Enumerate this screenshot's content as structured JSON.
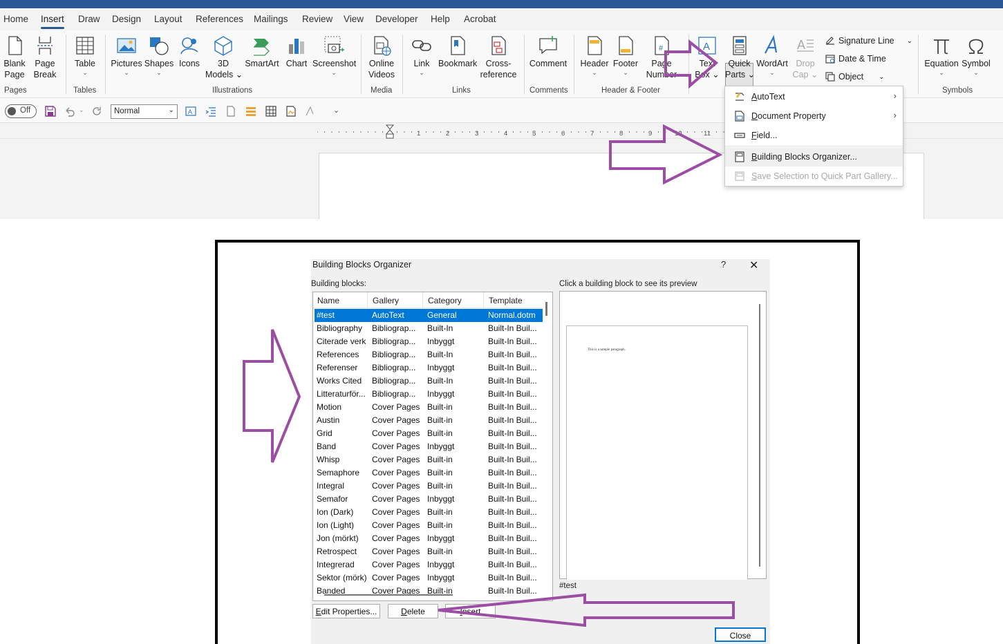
{
  "tabs": [
    "Home",
    "Insert",
    "Draw",
    "Design",
    "Layout",
    "References",
    "Mailings",
    "Review",
    "View",
    "Developer",
    "Help",
    "Acrobat"
  ],
  "active_tab": "Insert",
  "ribbon": {
    "blank_page": [
      "Blank",
      "Page"
    ],
    "page_break": [
      "Page",
      "Break"
    ],
    "table": "Table",
    "pictures": "Pictures",
    "shapes": "Shapes",
    "icons": "Icons",
    "models3d": [
      "3D",
      "Models"
    ],
    "smartart": "SmartArt",
    "chart": "Chart",
    "screenshot": "Screenshot",
    "online_videos": [
      "Online",
      "Videos"
    ],
    "link": "Link",
    "bookmark": "Bookmark",
    "cross_ref": [
      "Cross-",
      "reference"
    ],
    "comment": "Comment",
    "header": "Header",
    "footer": "Footer",
    "page_number": [
      "Page",
      "Number"
    ],
    "text_box": [
      "Text",
      "Box"
    ],
    "quick_parts": [
      "Quick",
      "Parts"
    ],
    "wordart": "WordArt",
    "drop_cap": [
      "Drop",
      "Cap"
    ],
    "signature_line": "Signature Line",
    "date_time": "Date & Time",
    "object": "Object",
    "equation": "Equation",
    "symbol": "Symbol",
    "groups": {
      "pages": "Pages",
      "tables": "Tables",
      "illustrations": "Illustrations",
      "media": "Media",
      "links": "Links",
      "comments": "Comments",
      "header_footer": "Header & Footer",
      "symbols": "Symbols"
    }
  },
  "quick_access": {
    "toggle": "Off",
    "style": "Normal"
  },
  "ruler_ticks": [
    "1",
    "2",
    "3",
    "4",
    "5",
    "6",
    "7",
    "8",
    "9",
    "10",
    "11"
  ],
  "quick_parts_menu": [
    {
      "label": "AutoText",
      "u": "A",
      "rest": "utoText",
      "submenu": true,
      "disabled": false
    },
    {
      "label": "Document Property",
      "u": "D",
      "rest": "ocument Property",
      "submenu": true,
      "disabled": false
    },
    {
      "label": "Field...",
      "u": "F",
      "rest": "ield...",
      "submenu": false,
      "disabled": false
    },
    {
      "label": "Building Blocks Organizer...",
      "u": "B",
      "rest": "uilding Blocks Organizer...",
      "submenu": false,
      "disabled": false
    },
    {
      "label": "Save Selection to Quick Part Gallery...",
      "u": "S",
      "rest": "ave Selection to Quick Part Gallery...",
      "submenu": false,
      "disabled": true
    }
  ],
  "dialog": {
    "title": "Building Blocks Organizer",
    "help": "?",
    "building_blocks_label": "Building blocks:",
    "preview_label": "Click a building block to see its preview",
    "columns": [
      "Name",
      "Gallery",
      "Category",
      "Template"
    ],
    "rows": [
      [
        "#test",
        "AutoText",
        "General",
        "Normal.dotm"
      ],
      [
        "Bibliography",
        "Bibliograp...",
        "Built-In",
        "Built-In Buil..."
      ],
      [
        "Citerade verk",
        "Bibliograp...",
        "Inbyggt",
        "Built-In Buil..."
      ],
      [
        "References",
        "Bibliograp...",
        "Built-In",
        "Built-In Buil..."
      ],
      [
        "Referenser",
        "Bibliograp...",
        "Inbyggt",
        "Built-In Buil..."
      ],
      [
        "Works Cited",
        "Bibliograp...",
        "Built-In",
        "Built-In Buil..."
      ],
      [
        "Litteraturför...",
        "Bibliograp...",
        "Inbyggt",
        "Built-In Buil..."
      ],
      [
        "Motion",
        "Cover Pages",
        "Built-in",
        "Built-In Buil..."
      ],
      [
        "Austin",
        "Cover Pages",
        "Built-in",
        "Built-In Buil..."
      ],
      [
        "Grid",
        "Cover Pages",
        "Built-in",
        "Built-In Buil..."
      ],
      [
        "Band",
        "Cover Pages",
        "Inbyggt",
        "Built-In Buil..."
      ],
      [
        "Whisp",
        "Cover Pages",
        "Built-in",
        "Built-In Buil..."
      ],
      [
        "Semaphore",
        "Cover Pages",
        "Built-in",
        "Built-In Buil..."
      ],
      [
        "Integral",
        "Cover Pages",
        "Built-in",
        "Built-In Buil..."
      ],
      [
        "Semafor",
        "Cover Pages",
        "Inbyggt",
        "Built-In Buil..."
      ],
      [
        "Ion (Dark)",
        "Cover Pages",
        "Built-in",
        "Built-In Buil..."
      ],
      [
        "Ion (Light)",
        "Cover Pages",
        "Built-in",
        "Built-In Buil..."
      ],
      [
        "Jon (mörkt)",
        "Cover Pages",
        "Inbyggt",
        "Built-In Buil..."
      ],
      [
        "Retrospect",
        "Cover Pages",
        "Built-in",
        "Built-In Buil..."
      ],
      [
        "Integrerad",
        "Cover Pages",
        "Inbyggt",
        "Built-In Buil..."
      ],
      [
        "Sektor (mörk)",
        "Cover Pages",
        "Inbyggt",
        "Built-In Buil..."
      ],
      [
        "Banded",
        "Cover Pages",
        "Built-in",
        "Built-In Buil..."
      ]
    ],
    "selected_row": 0,
    "preview_text": "This is a sample paragraph.",
    "preview_name": "#test",
    "buttons": {
      "edit_properties": {
        "u": "E",
        "rest": "dit Properties..."
      },
      "delete": {
        "u": "D",
        "rest": "elete"
      },
      "insert": {
        "u": "I",
        "rest": "nsert"
      },
      "close": "Close"
    }
  },
  "colors": {
    "accent": "#2b5797",
    "selection": "#0078d7",
    "annotation_arrow": "#9b4ea3"
  }
}
